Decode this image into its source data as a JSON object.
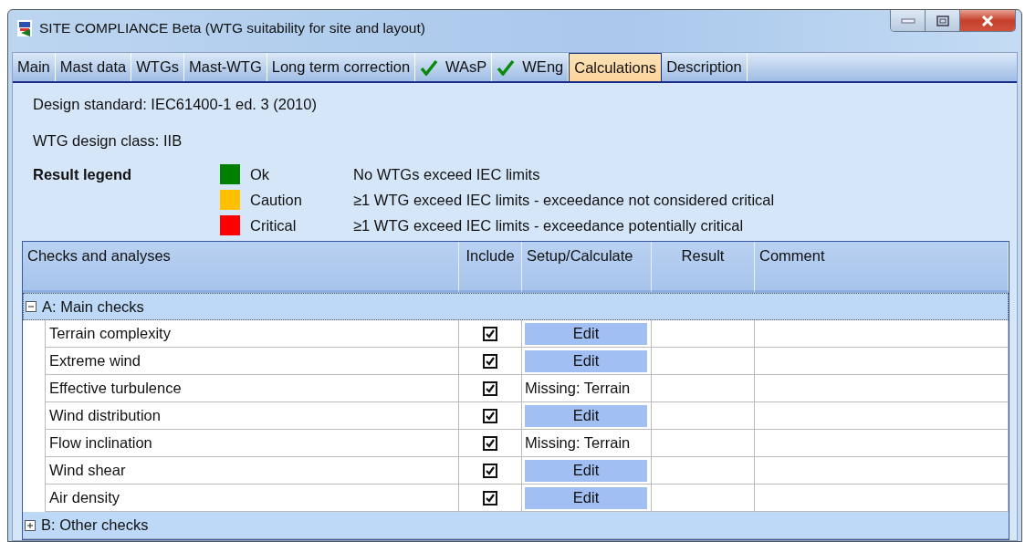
{
  "window": {
    "title": "SITE COMPLIANCE Beta (WTG suitability for site and layout)"
  },
  "tabs": [
    {
      "label": "Main",
      "checked": false,
      "selected": false
    },
    {
      "label": "Mast data",
      "checked": false,
      "selected": false
    },
    {
      "label": "WTGs",
      "checked": false,
      "selected": false
    },
    {
      "label": "Mast-WTG",
      "checked": false,
      "selected": false
    },
    {
      "label": "Long term correction",
      "checked": false,
      "selected": false
    },
    {
      "label": "WAsP",
      "checked": true,
      "selected": false
    },
    {
      "label": "WEng",
      "checked": true,
      "selected": false
    },
    {
      "label": "Calculations",
      "checked": false,
      "selected": true
    },
    {
      "label": "Description",
      "checked": false,
      "selected": false
    }
  ],
  "info": [
    "Design standard: IEC61400-1 ed. 3 (2010)",
    "WTG design class: IIB"
  ],
  "legend": {
    "title": "Result legend",
    "items": [
      {
        "label": "Ok",
        "color": "#008000",
        "description": "No WTGs exceed IEC limits"
      },
      {
        "label": "Caution",
        "color": "#ffc000",
        "description": "≥1 WTG exceed IEC limits - exceedance not considered critical"
      },
      {
        "label": "Critical",
        "color": "#ff0000",
        "description": "≥1 WTG exceed IEC limits - exceedance potentially critical"
      }
    ]
  },
  "table": {
    "columns": [
      "Checks and analyses",
      "Include",
      "Setup/Calculate",
      "Result",
      "Comment"
    ],
    "groups": [
      {
        "label": "A: Main checks",
        "expanded": true,
        "selected": true,
        "children": [
          {
            "name": "Terrain complexity",
            "include": true,
            "setup": {
              "kind": "button",
              "label": "Edit"
            }
          },
          {
            "name": "Extreme wind",
            "include": true,
            "setup": {
              "kind": "button",
              "label": "Edit"
            }
          },
          {
            "name": "Effective turbulence",
            "include": true,
            "setup": {
              "kind": "text",
              "label": "Missing: Terrain"
            }
          },
          {
            "name": "Wind distribution",
            "include": true,
            "setup": {
              "kind": "button",
              "label": "Edit"
            }
          },
          {
            "name": "Flow inclination",
            "include": true,
            "setup": {
              "kind": "text",
              "label": "Missing: Terrain"
            }
          },
          {
            "name": "Wind shear",
            "include": true,
            "setup": {
              "kind": "button",
              "label": "Edit"
            }
          },
          {
            "name": "Air density",
            "include": true,
            "setup": {
              "kind": "button",
              "label": "Edit"
            }
          }
        ]
      },
      {
        "label": "B: Other checks",
        "expanded": false,
        "selected": false
      }
    ]
  }
}
